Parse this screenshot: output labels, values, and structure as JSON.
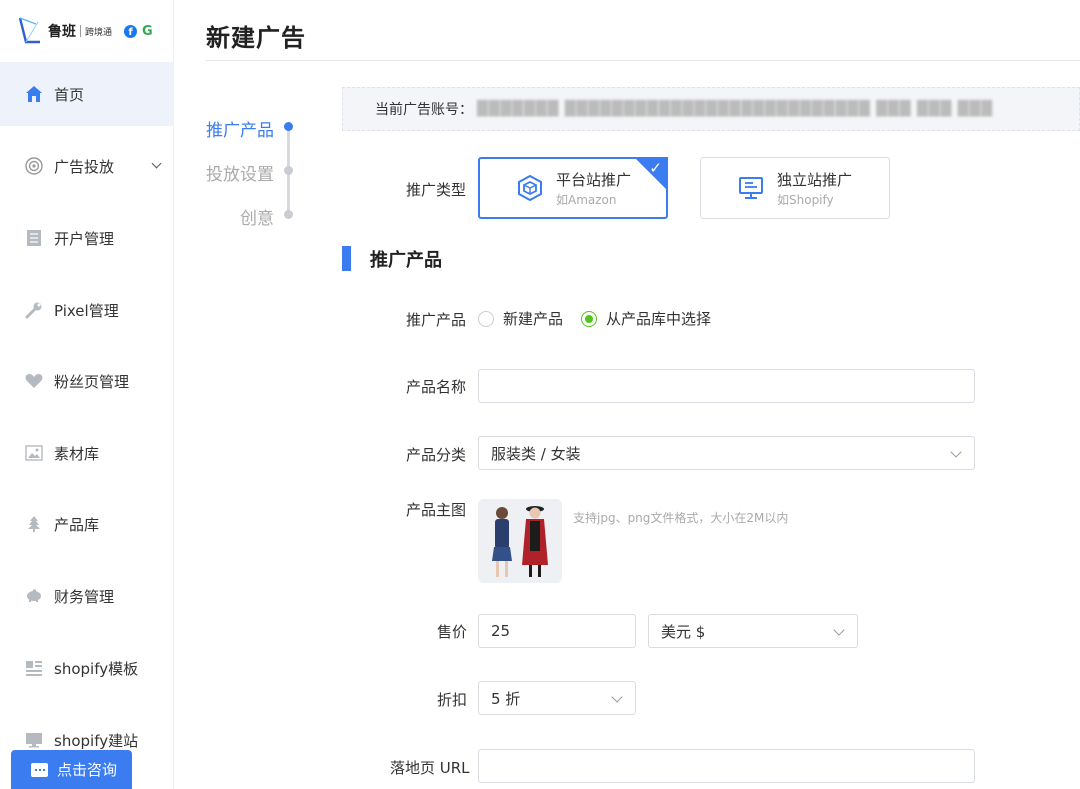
{
  "brand": {
    "name": "鲁班",
    "subtitle": "跨境通",
    "facebook_glyph": "f",
    "google_glyph": "G"
  },
  "sidebar": {
    "items": [
      {
        "label": "首页",
        "icon": "home-icon",
        "active": true
      },
      {
        "label": "广告投放",
        "icon": "target-icon",
        "active": false,
        "expandable": true
      },
      {
        "label": "开户管理",
        "icon": "document-icon",
        "active": false
      },
      {
        "label": "Pixel管理",
        "icon": "wrench-icon",
        "active": false
      },
      {
        "label": "粉丝页管理",
        "icon": "heart-icon",
        "active": false
      },
      {
        "label": "素材库",
        "icon": "image-icon",
        "active": false
      },
      {
        "label": "产品库",
        "icon": "tree-icon",
        "active": false
      },
      {
        "label": "财务管理",
        "icon": "piggy-bank-icon",
        "active": false
      },
      {
        "label": "shopify模板",
        "icon": "template-icon",
        "active": false
      },
      {
        "label": "shopify建站",
        "icon": "monitor-icon",
        "active": false
      }
    ],
    "consult_label": "点击咨询"
  },
  "header": {
    "title": "新建广告"
  },
  "steps": [
    {
      "label": "推广产品",
      "active": true
    },
    {
      "label": "投放设置",
      "active": false
    },
    {
      "label": "创意",
      "active": false
    }
  ],
  "account": {
    "label": "当前广告账号：",
    "value": "███████ ██████████████████████████ ███ ███ ███"
  },
  "promo_type": {
    "label": "推广类型",
    "options": [
      {
        "title": "平台站推广",
        "subtitle": "如Amazon",
        "selected": true
      },
      {
        "title": "独立站推广",
        "subtitle": "如Shopify",
        "selected": false
      }
    ]
  },
  "section": {
    "title": "推广产品"
  },
  "form": {
    "product_source": {
      "label": "推广产品",
      "options": [
        "新建产品",
        "从产品库中选择"
      ],
      "selected": "从产品库中选择"
    },
    "product_name": {
      "label": "产品名称",
      "value": ""
    },
    "category": {
      "label": "产品分类",
      "value": "服装类 / 女装"
    },
    "main_image": {
      "label": "产品主图",
      "hint": "支持jpg、png文件格式，大小在2M以内"
    },
    "price": {
      "label": "售价",
      "value": "25",
      "currency": "美元 $"
    },
    "discount": {
      "label": "折扣",
      "value": "5 折"
    },
    "landing_url": {
      "label": "落地页 URL",
      "value": ""
    }
  },
  "colors": {
    "accent": "#3b7cf0",
    "radio_checked": "#52c41a"
  }
}
